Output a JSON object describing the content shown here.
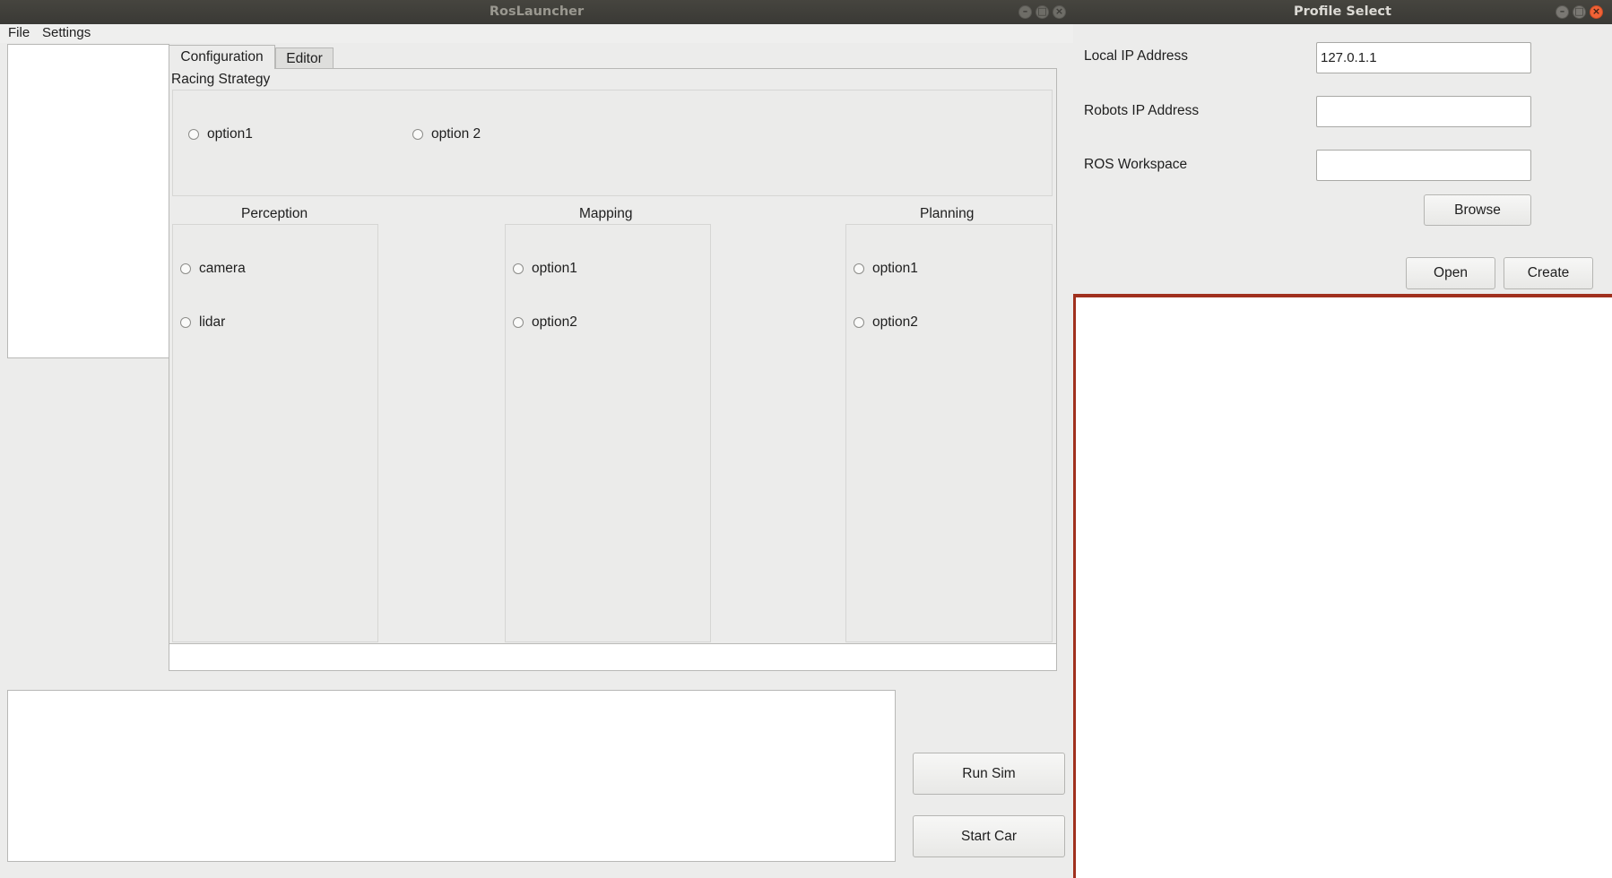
{
  "main_window": {
    "title": "RosLauncher",
    "menu": [
      "File",
      "Settings"
    ],
    "tabs": [
      "Configuration",
      "Editor"
    ],
    "racing_strategy": {
      "title": "Racing Strategy",
      "options": [
        "option1",
        "option 2"
      ]
    },
    "perception": {
      "title": "Perception",
      "options": [
        "camera",
        "lidar"
      ]
    },
    "mapping": {
      "title": "Mapping",
      "options": [
        "option1",
        "option2"
      ]
    },
    "planning": {
      "title": "Planning",
      "options": [
        "option1",
        "option2"
      ]
    },
    "buttons": {
      "run_sim": "Run Sim",
      "start_car": "Start Car"
    }
  },
  "profile_window": {
    "title": "Profile Select",
    "fields": {
      "local_ip": {
        "label": "Local IP Address",
        "value": "127.0.1.1"
      },
      "robots_ip": {
        "label": "Robots IP Address",
        "value": ""
      },
      "ros_workspace": {
        "label": "ROS Workspace",
        "value": ""
      }
    },
    "buttons": {
      "browse": "Browse",
      "open": "Open",
      "create": "Create"
    }
  },
  "colors": {
    "titlebar": "#3c3b37",
    "close_button": "#f06236",
    "accent_border": "#a0301e",
    "window_bg": "#ececeb"
  },
  "icons": [
    "minimize-icon",
    "maximize-icon",
    "close-icon"
  ]
}
